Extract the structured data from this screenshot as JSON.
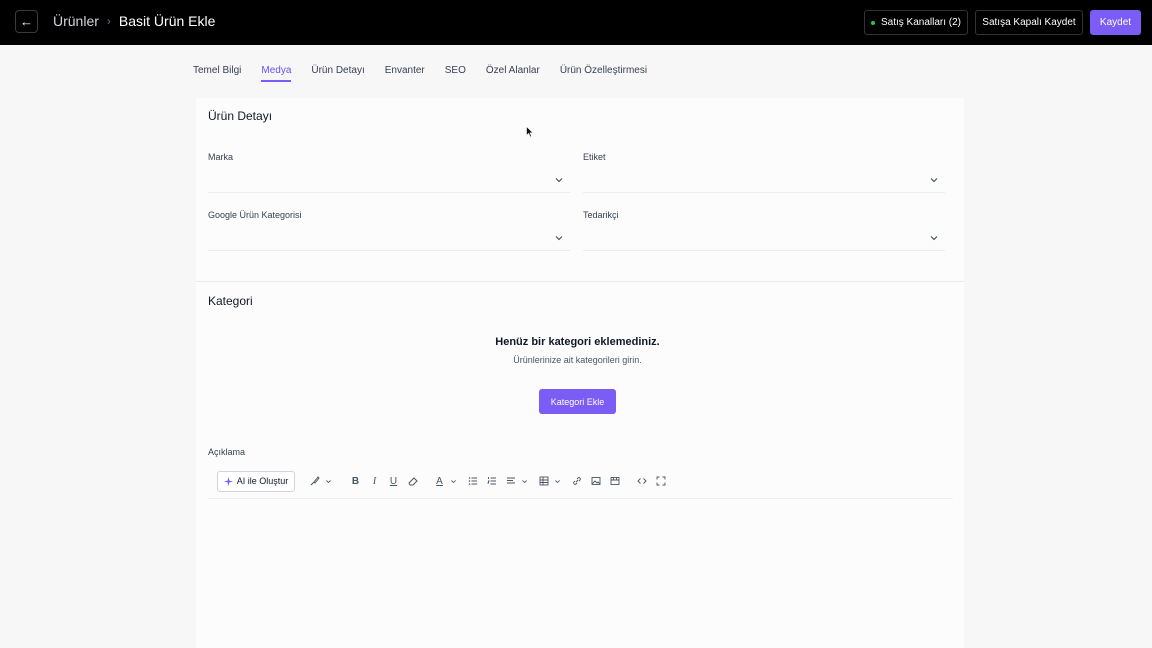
{
  "header": {
    "back_icon": "arrow-left-icon",
    "breadcrumb_root": "Ürünler",
    "breadcrumb_separator": "›",
    "breadcrumb_current": "Basit Ürün Ekle",
    "channels_label": "Satış Kanalları (2)",
    "channels_status_color": "#22c55e",
    "save_closed_label": "Satışa Kapalı Kaydet",
    "save_label": "Kaydet",
    "accent_color": "#7b5cf5"
  },
  "tabs": [
    {
      "label": "Temel Bilgi",
      "active": false
    },
    {
      "label": "Medya",
      "active": true
    },
    {
      "label": "Ürün Detayı",
      "active": false
    },
    {
      "label": "Envanter",
      "active": false
    },
    {
      "label": "SEO",
      "active": false
    },
    {
      "label": "Özel Alanlar",
      "active": false
    },
    {
      "label": "Ürün Özelleştirmesi",
      "active": false
    }
  ],
  "product_detail": {
    "title": "Ürün Detayı",
    "brand_label": "Marka",
    "brand_value": "",
    "tag_label": "Etiket",
    "tag_value": "",
    "google_category_label": "Google Ürün Kategorisi",
    "google_category_value": "",
    "supplier_label": "Tedarikçi",
    "supplier_value": ""
  },
  "category": {
    "title": "Kategori",
    "empty_title": "Henüz bir kategori eklemediniz.",
    "empty_subtitle": "Ürünlerinize ait kategorileri girin.",
    "add_button": "Kategori Ekle"
  },
  "description": {
    "label": "Açıklama",
    "ai_button": "AI ile Oluştur",
    "toolbar_icons": [
      "paintbrush-icon",
      "bold-icon",
      "italic-icon",
      "underline-icon",
      "eraser-icon",
      "text-color-icon",
      "bullet-list-icon",
      "numbered-list-icon",
      "align-icon",
      "table-icon",
      "link-icon",
      "image-icon",
      "video-icon",
      "code-icon",
      "fullscreen-icon"
    ]
  }
}
